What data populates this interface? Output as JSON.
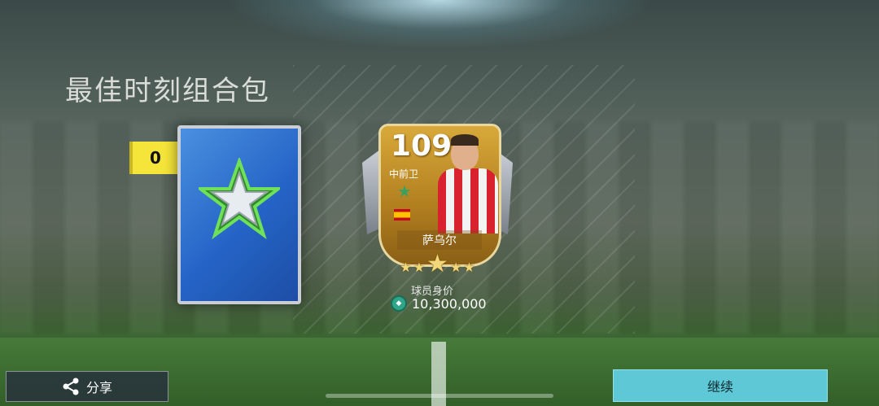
{
  "page": {
    "title": "最佳时刻组合包"
  },
  "pack": {
    "count": "0",
    "icon": "silver-green-star-icon",
    "color": "#2564c6"
  },
  "card": {
    "rating": "109",
    "position": "中前卫",
    "name": "萨乌尔",
    "nation_flag": "spain-flag-icon",
    "stars": 5
  },
  "value": {
    "label": "球员身价",
    "amount": "10,300,000",
    "icon": "coin-icon"
  },
  "buttons": {
    "share_label": "分享",
    "continue_label": "继续"
  },
  "colors": {
    "badge": "#f5e43a",
    "continue": "#5fc8d6",
    "card_gold": "#d8a93a"
  }
}
